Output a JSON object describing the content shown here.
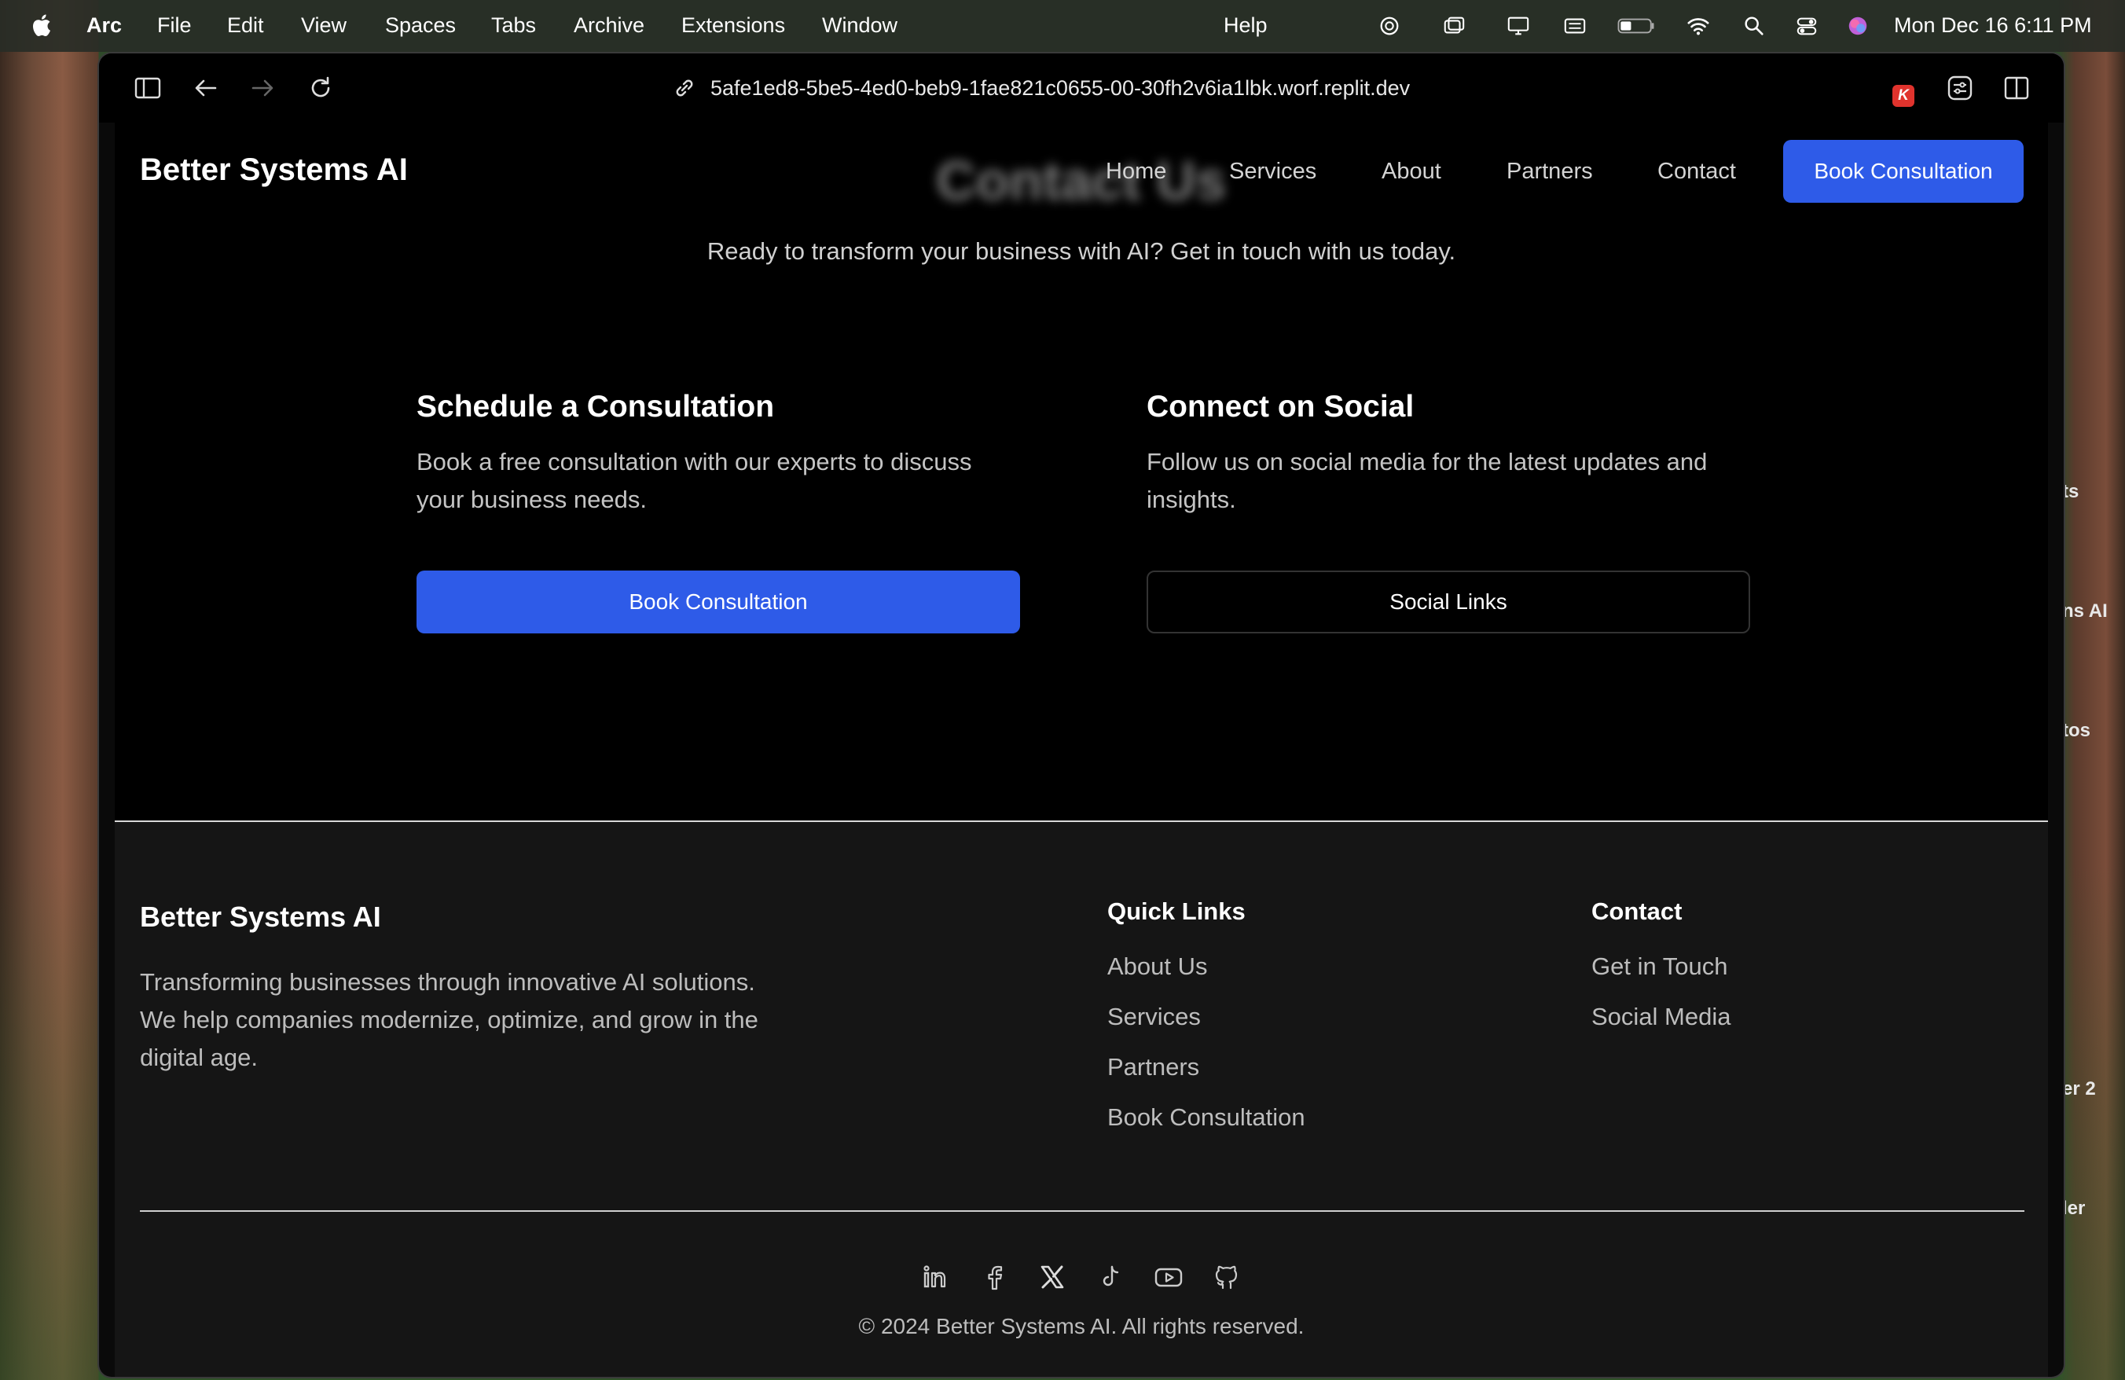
{
  "menubar": {
    "app_name": "Arc",
    "items": [
      "File",
      "Edit",
      "View",
      "Spaces",
      "Tabs",
      "Archive",
      "Extensions",
      "Window"
    ],
    "help": "Help",
    "clock": "Mon Dec 16  6:11 PM"
  },
  "side_snippets": [
    "ts",
    "ns AI",
    "tos",
    "er 2",
    "ler"
  ],
  "browser": {
    "url": "5afe1ed8-5be5-4ed0-beb9-1fae821c0655-00-30fh2v6ia1lbk.worf.replit.dev",
    "extension_badge": "K"
  },
  "site": {
    "brand": "Better Systems AI",
    "ghost_title": "Contact Us",
    "nav": [
      "Home",
      "Services",
      "About",
      "Partners",
      "Contact"
    ],
    "nav_cta": "Book Consultation",
    "subtitle": "Ready to transform your business with AI? Get in touch with us today.",
    "schedule": {
      "title": "Schedule a Consultation",
      "text": "Book a free consultation with our experts to discuss your business needs.",
      "button": "Book Consultation"
    },
    "social": {
      "title": "Connect on Social",
      "text": "Follow us on social media for the latest updates and insights.",
      "button": "Social Links"
    }
  },
  "footer": {
    "brand": "Better Systems AI",
    "description": "Transforming businesses through innovative AI solutions. We help companies modernize, optimize, and grow in the digital age.",
    "quick_links": {
      "title": "Quick Links",
      "items": [
        "About Us",
        "Services",
        "Partners",
        "Book Consultation"
      ]
    },
    "contact": {
      "title": "Contact",
      "items": [
        "Get in Touch",
        "Social Media"
      ]
    },
    "social_icons": [
      "linkedin-icon",
      "facebook-icon",
      "x-icon",
      "tiktok-icon",
      "youtube-icon",
      "github-icon"
    ],
    "copyright": "© 2024 Better Systems AI. All rights reserved."
  },
  "colors": {
    "accent": "#2e5be8",
    "page_background": "#000000",
    "footer_background": "#151515"
  }
}
